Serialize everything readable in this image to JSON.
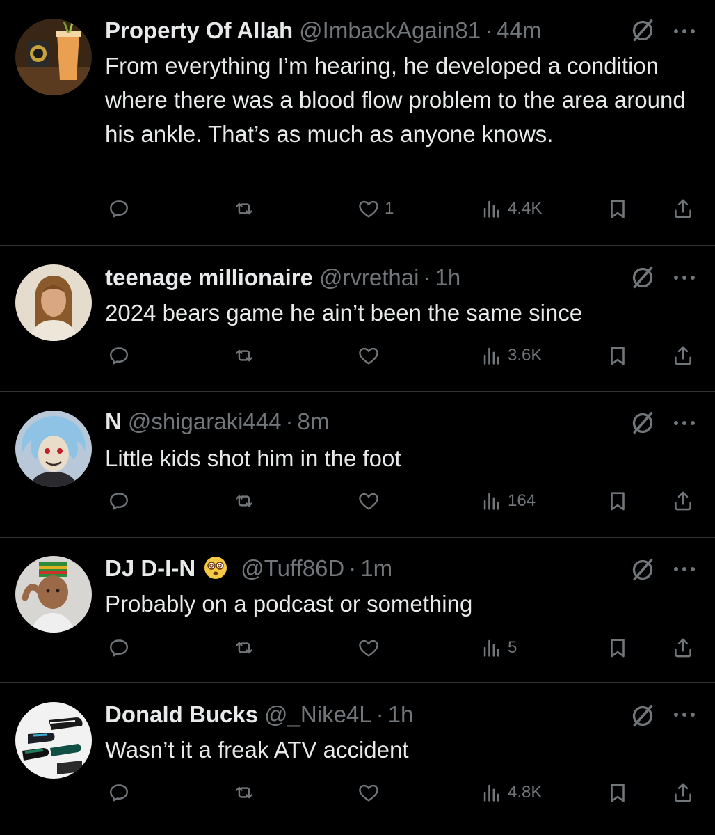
{
  "tweets": [
    {
      "name": "Property Of Allah",
      "handle": "@ImbackAgain81",
      "dot": "·",
      "time": "44m",
      "text": "From everything I’m hearing, he developed a condition where there was a blood flow problem to the area around his ankle. That’s as much as anyone knows.",
      "likes": "1",
      "views": "4.4K"
    },
    {
      "name": "teenage millionaire",
      "handle": "@rvrethai",
      "dot": "·",
      "time": "1h",
      "text": "2024 bears game he ain’t been the same since",
      "likes": "",
      "views": "3.6K"
    },
    {
      "name": "N",
      "handle": "@shigaraki444",
      "dot": "·",
      "time": "8m",
      "text": "Little kids shot him in the foot",
      "likes": "",
      "views": "164"
    },
    {
      "name": "DJ D-I-N",
      "handle": "@Tuff86D",
      "dot": "·",
      "time": "1m",
      "text": "Probably on a podcast or something",
      "likes": "",
      "views": "5"
    },
    {
      "name": "Donald Bucks",
      "handle": "@_Nike4L",
      "dot": "·",
      "time": "1h",
      "text": "Wasn’t it a freak ATV accident",
      "likes": "",
      "views": "4.8K"
    }
  ],
  "icons": {
    "reply": "reply-icon",
    "repost": "repost-icon",
    "like": "heart-icon",
    "views": "views-icon",
    "bookmark": "bookmark-icon",
    "share": "share-icon",
    "grok": "grok-icon",
    "more": "more-icon",
    "emoji": "dizzy-face-emoji"
  },
  "colors": {
    "background": "#000000",
    "primary_text": "#e7e9ea",
    "secondary_text": "#71767b",
    "divider": "#2f3336"
  }
}
